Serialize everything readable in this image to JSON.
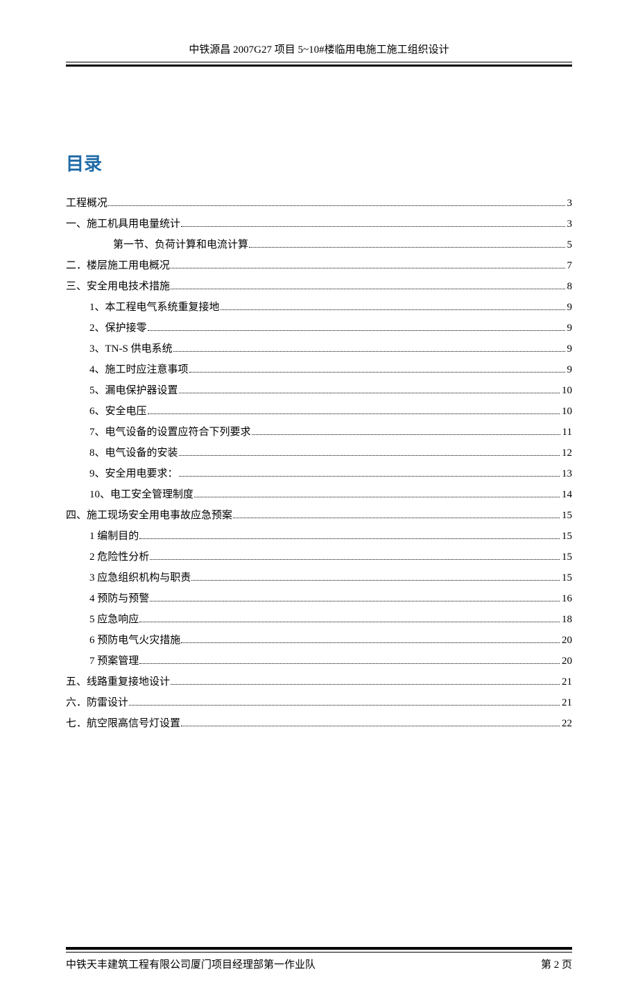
{
  "header": {
    "title": "中铁源昌 2007G27 项目 5~10#楼临用电施工施工组织设计"
  },
  "toc": {
    "heading": "目录",
    "entries": [
      {
        "level": 1,
        "label": "工程概况",
        "page": "3"
      },
      {
        "level": 1,
        "label": "一、施工机具用电量统计",
        "page": "3"
      },
      {
        "level": 3,
        "label": "第一节、负荷计算和电流计算",
        "page": "5"
      },
      {
        "level": 1,
        "label": "二．楼层施工用电概况",
        "page": "7"
      },
      {
        "level": 1,
        "label": "三、安全用电技术措施",
        "page": "8"
      },
      {
        "level": 2,
        "label": "1、本工程电气系统重复接地",
        "page": "9"
      },
      {
        "level": 2,
        "label": "2、保护接零",
        "page": "9"
      },
      {
        "level": 2,
        "label": "3、TN-S 供电系统",
        "page": "9"
      },
      {
        "level": 2,
        "label": "4、施工时应注意事项",
        "page": "9"
      },
      {
        "level": 2,
        "label": "5、漏电保护器设置",
        "page": "10"
      },
      {
        "level": 2,
        "label": "6、安全电压",
        "page": "10"
      },
      {
        "level": 2,
        "label": "7、电气设备的设置应符合下列要求",
        "page": "11"
      },
      {
        "level": 2,
        "label": "8、电气设备的安装",
        "page": "12"
      },
      {
        "level": 2,
        "label": "9、安全用电要求：",
        "page": "13"
      },
      {
        "level": 2,
        "label": "10、电工安全管理制度",
        "page": "14"
      },
      {
        "level": 1,
        "label": "四、施工现场安全用电事故应急预案",
        "page": "15"
      },
      {
        "level": 2,
        "label": "1  编制目的",
        "page": "15"
      },
      {
        "level": 2,
        "label": "2  危险性分析",
        "page": "15"
      },
      {
        "level": 2,
        "label": "3  应急组织机构与职责",
        "page": "15"
      },
      {
        "level": 2,
        "label": "4  预防与预警",
        "page": "16"
      },
      {
        "level": 2,
        "label": "5  应急响应",
        "page": "18"
      },
      {
        "level": 2,
        "label": "6  预防电气火灾措施",
        "page": "20"
      },
      {
        "level": 2,
        "label": "7  预案管理",
        "page": "20"
      },
      {
        "level": 1,
        "label": "五、线路重复接地设计",
        "page": "21"
      },
      {
        "level": 1,
        "label": "六．防雷设计",
        "page": "21"
      },
      {
        "level": 1,
        "label": "七．航空限高信号灯设置",
        "page": "22"
      }
    ]
  },
  "footer": {
    "left": "中铁天丰建筑工程有限公司厦门项目经理部第一作业队",
    "right": "第 2 页"
  }
}
